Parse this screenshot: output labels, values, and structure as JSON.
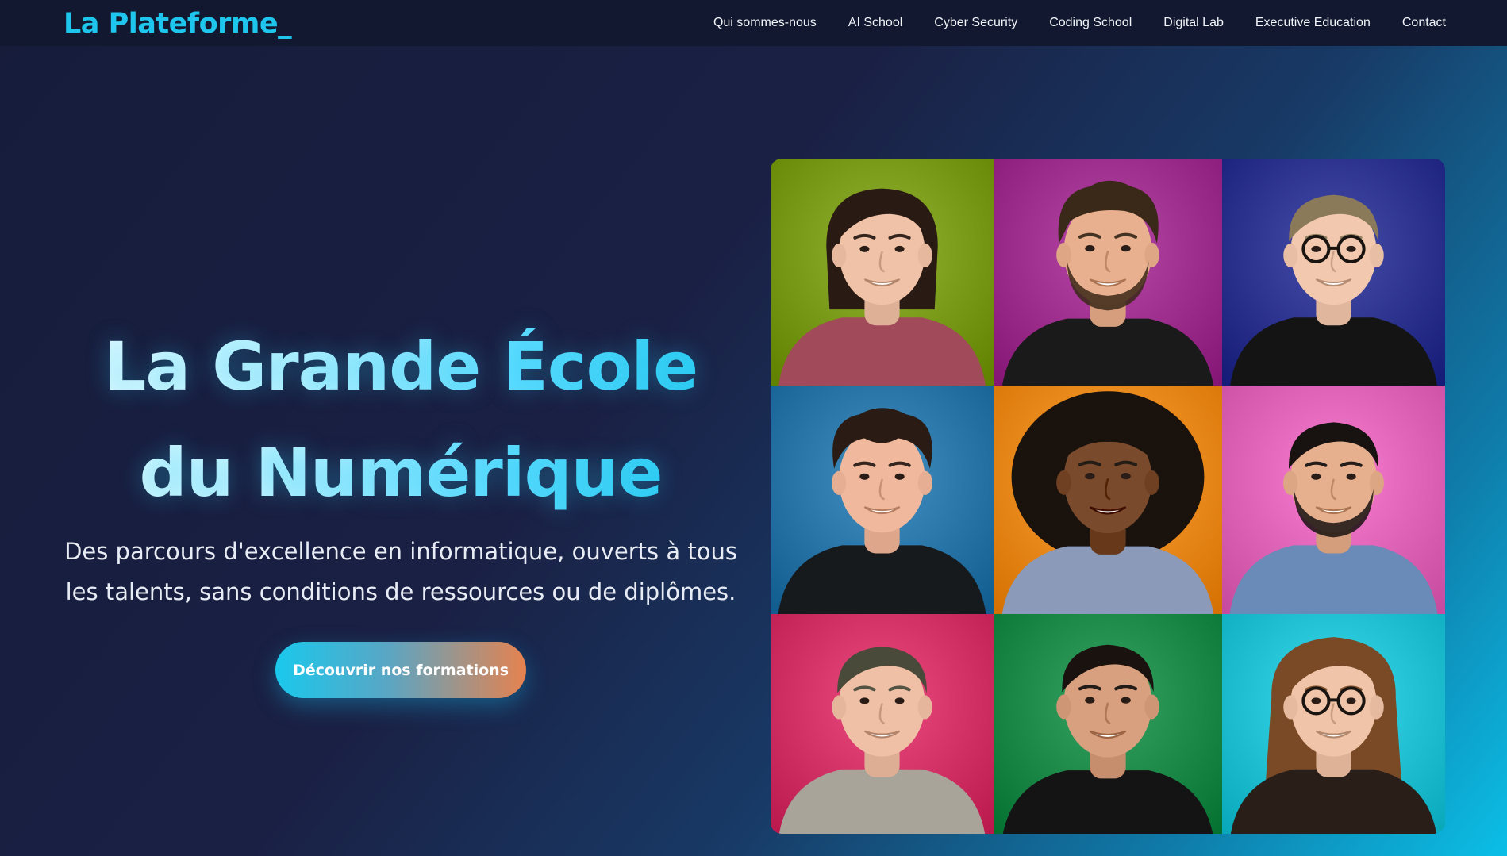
{
  "brand": {
    "logo_text": "La Plateforme_",
    "accent_color": "#1ec6ee"
  },
  "nav": {
    "items": [
      {
        "label": "Qui sommes-nous"
      },
      {
        "label": "AI School"
      },
      {
        "label": "Cyber Security"
      },
      {
        "label": "Coding School"
      },
      {
        "label": "Digital Lab"
      },
      {
        "label": "Executive Education"
      },
      {
        "label": "Contact"
      }
    ]
  },
  "hero": {
    "title": "La Grande École du Numérique",
    "subtitle": "Des parcours d'excellence en informatique, ouverts à tous les talents, sans conditions de ressources ou de diplômes.",
    "cta_label": "Découvrir nos formations"
  },
  "portraits": [
    {
      "name": "person-1",
      "bg": "#7a9a1a",
      "skin": "#f0c2a8",
      "hair": "#2a1a14",
      "shirt": "#a14a5a",
      "hair_style": "bob",
      "glasses": false,
      "beard": false
    },
    {
      "name": "person-2",
      "bg": "#9e2f8e",
      "skin": "#e8b08e",
      "hair": "#3a2818",
      "shirt": "#1a1a1a",
      "hair_style": "messy",
      "glasses": false,
      "beard": true
    },
    {
      "name": "person-3",
      "bg": "#2e3590",
      "skin": "#f2c8ae",
      "hair": "#8a7a5a",
      "shirt": "#141414",
      "hair_style": "short",
      "glasses": true,
      "beard": false
    },
    {
      "name": "person-4",
      "bg": "#2a76a8",
      "skin": "#f0b89c",
      "hair": "#2a1c14",
      "shirt": "#161a1c",
      "hair_style": "curly",
      "glasses": false,
      "beard": false
    },
    {
      "name": "person-5",
      "bg": "#ee8a1c",
      "skin": "#7a4a2c",
      "hair": "#1a120c",
      "shirt": "#8a9ab8",
      "hair_style": "afro",
      "glasses": false,
      "beard": false
    },
    {
      "name": "person-6",
      "bg": "#e064b8",
      "skin": "#e6b08e",
      "hair": "#181210",
      "shirt": "#6a8ab8",
      "hair_style": "short",
      "glasses": false,
      "beard": true
    },
    {
      "name": "person-7",
      "bg": "#d23266",
      "skin": "#f0c0a6",
      "hair": "#4a4a3a",
      "shirt": "#a8a49a",
      "hair_style": "short",
      "glasses": false,
      "beard": false
    },
    {
      "name": "person-8",
      "bg": "#1e8a4a",
      "skin": "#d8a07e",
      "hair": "#1a120e",
      "shirt": "#141414",
      "hair_style": "short",
      "glasses": false,
      "beard": false
    },
    {
      "name": "person-9",
      "bg": "#22c2d4",
      "skin": "#f0c4a8",
      "hair": "#7a4a26",
      "shirt": "#2a1e18",
      "hair_style": "long",
      "glasses": true,
      "beard": false
    }
  ]
}
